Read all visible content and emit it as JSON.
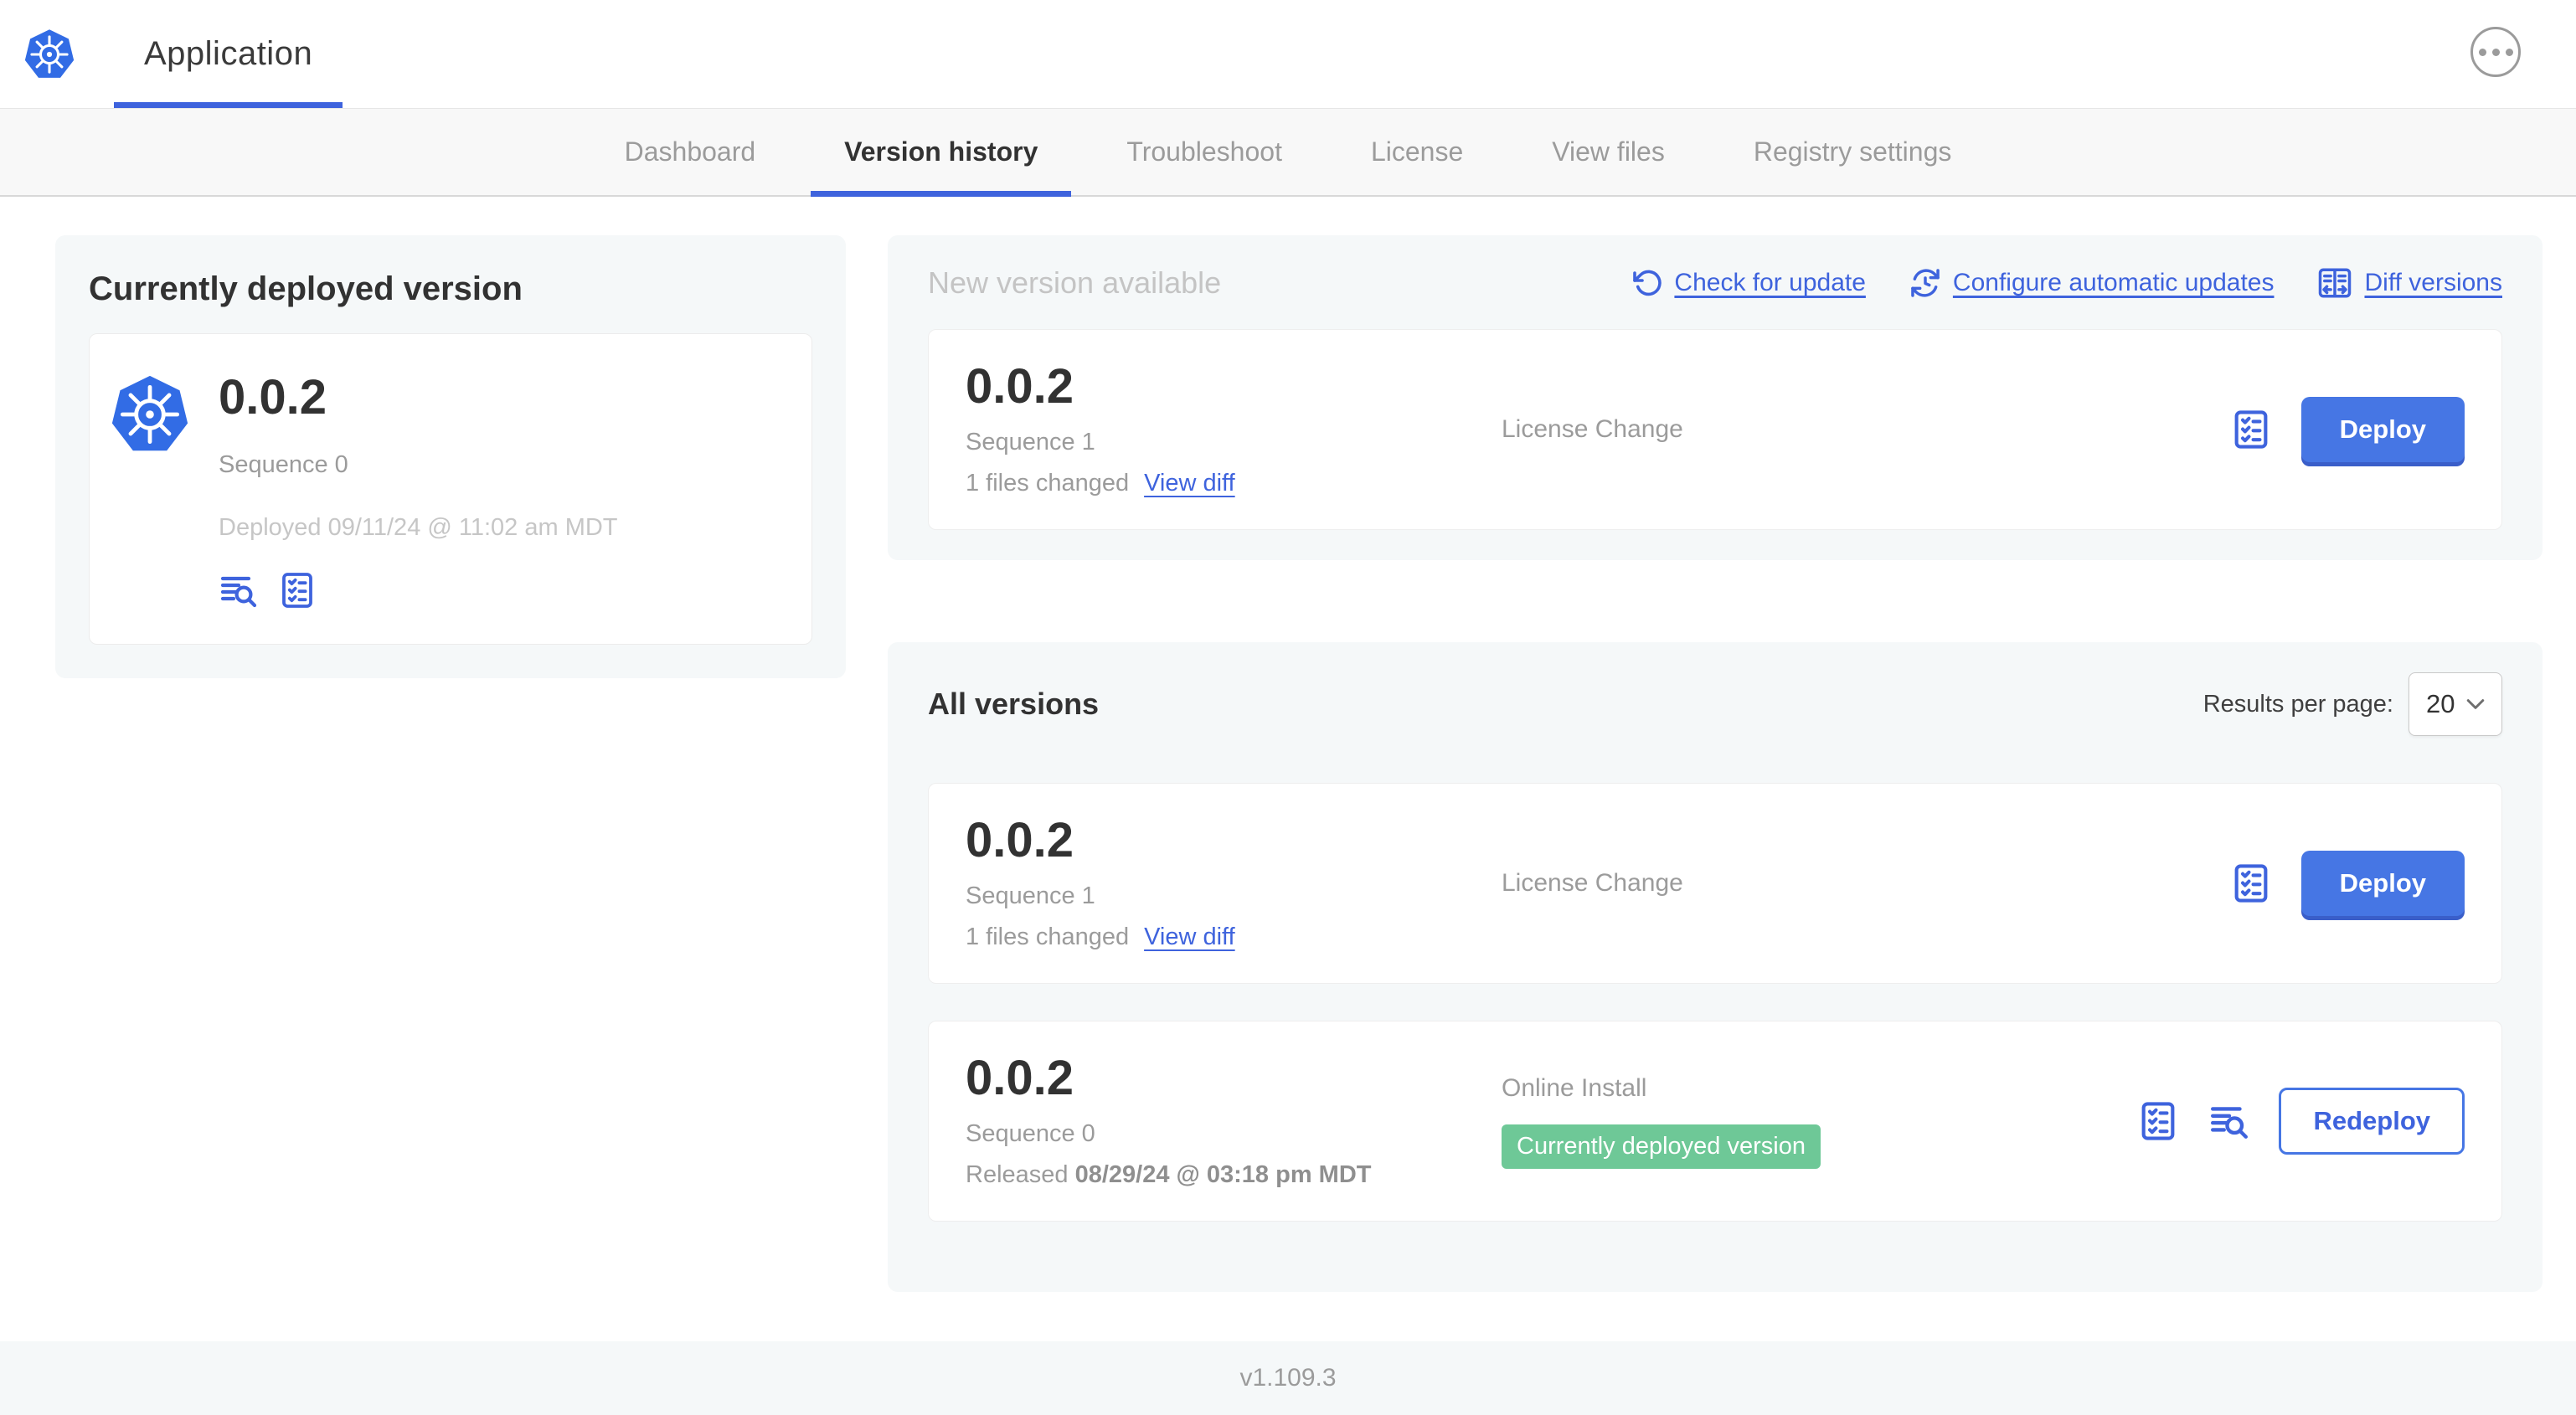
{
  "colors": {
    "primary_blue": "#4676e4",
    "link_blue": "#3e63dd",
    "kubernetes_blue": "#326ce5",
    "badge_green": "#6ec897",
    "panel_gray": "#f5f8f9"
  },
  "header": {
    "app_tab_label": "Application"
  },
  "subnav": {
    "active_tab": "Version history",
    "tabs": [
      "Dashboard",
      "Version history",
      "Troubleshoot",
      "License",
      "View files",
      "Registry settings"
    ]
  },
  "current_version": {
    "section_title": "Currently deployed version",
    "version": "0.0.2",
    "sequence": "Sequence 0",
    "deployed_timestamp": "Deployed 09/11/24 @ 11:02 am MDT"
  },
  "new_version": {
    "section_title": "New version available",
    "actions": {
      "check_for_update": "Check for update",
      "configure_automatic_updates": "Configure automatic updates",
      "diff_versions": "Diff versions"
    },
    "card": {
      "version": "0.0.2",
      "sequence": "Sequence 1",
      "files_changed": "1 files changed",
      "view_diff_label": "View diff",
      "source": "License Change",
      "deploy_label": "Deploy"
    }
  },
  "all_versions": {
    "section_title": "All versions",
    "results_per_page_label": "Results per page:",
    "results_per_page_value": "20",
    "rows": [
      {
        "version": "0.0.2",
        "sequence": "Sequence 1",
        "files_changed": "1 files changed",
        "view_diff_label": "View diff",
        "source": "License Change",
        "action_label": "Deploy"
      },
      {
        "version": "0.0.2",
        "sequence": "Sequence 0",
        "released_prefix": "Released",
        "released_timestamp": "08/29/24 @ 03:18 pm MDT",
        "source": "Online Install",
        "status_badge": "Currently deployed version",
        "action_label": "Redeploy"
      }
    ]
  },
  "footer": {
    "console_version": "v1.109.3"
  }
}
